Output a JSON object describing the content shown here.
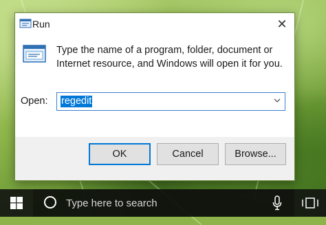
{
  "dialog": {
    "title": "Run",
    "close_symbol": "✕",
    "description": "Type the name of a program, folder, document or Internet resource, and Windows will open it for you.",
    "open_label": "Open:",
    "open_value": "regedit",
    "buttons": {
      "ok": "OK",
      "cancel": "Cancel",
      "browse": "Browse..."
    },
    "icons": {
      "title": "run-app-icon",
      "body": "run-window-icon",
      "combo": "chevron-down-icon",
      "close": "close-icon"
    },
    "colors": {
      "selection": "#0078d7",
      "focus_border": "#3b7fd1"
    }
  },
  "taskbar": {
    "search_placeholder": "Type here to search",
    "icons": {
      "start": "windows-logo-icon",
      "cortana": "cortana-circle-icon",
      "mic": "microphone-icon",
      "task_view": "task-view-icon"
    }
  }
}
